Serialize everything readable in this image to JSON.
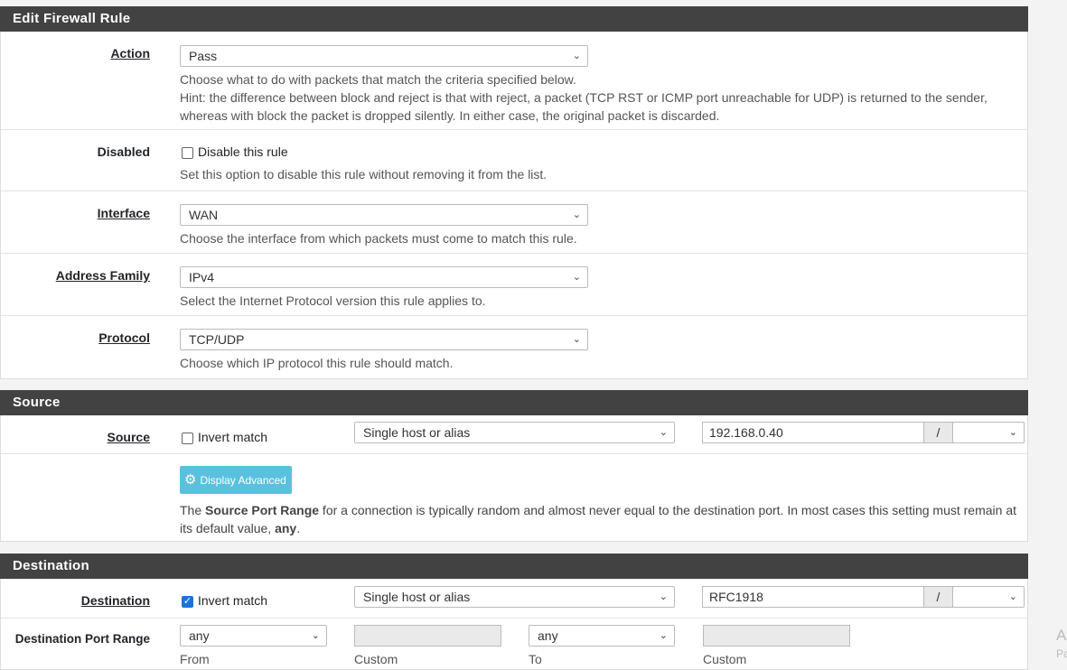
{
  "edit": {
    "title": "Edit Firewall Rule",
    "action": {
      "label": "Action",
      "value": "Pass",
      "help1": "Choose what to do with packets that match the criteria specified below.",
      "help2": "Hint: the difference between block and reject is that with reject, a packet (TCP RST or ICMP port unreachable for UDP) is returned to the sender,",
      "help3": "whereas with block the packet is dropped silently. In either case, the original packet is discarded."
    },
    "disabled": {
      "label": "Disabled",
      "checkbox_label": "Disable this rule",
      "checked": false,
      "help": "Set this option to disable this rule without removing it from the list."
    },
    "interface": {
      "label": "Interface",
      "value": "WAN",
      "help": "Choose the interface from which packets must come to match this rule."
    },
    "address_family": {
      "label": "Address Family",
      "value": "IPv4",
      "help": "Select the Internet Protocol version this rule applies to."
    },
    "protocol": {
      "label": "Protocol",
      "value": "TCP/UDP",
      "help": "Choose which IP protocol this rule should match."
    }
  },
  "source": {
    "title": "Source",
    "label": "Source",
    "invert_label": "Invert match",
    "invert_checked": false,
    "type": "Single host or alias",
    "address": "192.168.0.40",
    "slash": "/",
    "mask": "",
    "advanced_button": "Display Advanced",
    "help_pre": "The ",
    "help_bold1": "Source Port Range",
    "help_mid": " for a connection is typically random and almost never equal to the destination port. In most cases this setting must remain at",
    "help_line2_pre": "its default value, ",
    "help_bold2": "any",
    "help_end": "."
  },
  "destination": {
    "title": "Destination",
    "label": "Destination",
    "invert_label": "Invert match",
    "invert_checked": true,
    "type": "Single host or alias",
    "address": "RFC1918",
    "slash": "/",
    "mask": "",
    "port_range_label": "Destination Port Range",
    "from_value": "any",
    "from_label": "From",
    "from_custom_label": "Custom",
    "to_value": "any",
    "to_label": "To",
    "to_custom_label": "Custom"
  },
  "edge_text": {
    "a": "A",
    "b": "Pa"
  },
  "colors": {
    "header": "#424242",
    "info_button": "#5bc0de",
    "checkbox_checked": "#1e73d9"
  },
  "icons": [
    "chevron-down-icon",
    "gear-icon",
    "checkmark-icon"
  ]
}
